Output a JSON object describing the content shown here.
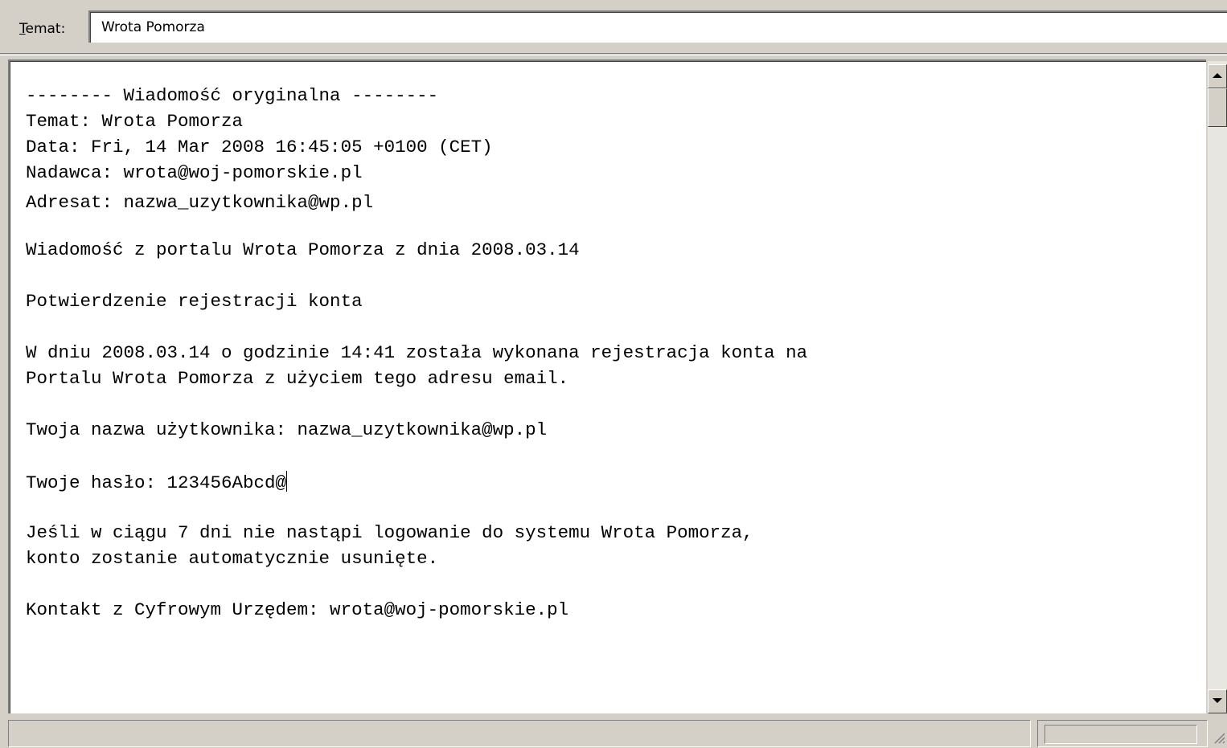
{
  "subject": {
    "label_accel": "T",
    "label_rest": "emat:",
    "value": "Wrota Pomorza"
  },
  "body": {
    "lines": [
      "-------- Wiadomość oryginalna --------",
      "Temat: Wrota Pomorza",
      "Data: Fri, 14 Mar 2008 16:45:05 +0100 (CET)",
      "Nadawca: wrota@woj-pomorskie.pl",
      "Adresat: nazwa_uzytkownika@wp.pl",
      "Wiadomość z portalu Wrota Pomorza z dnia 2008.03.14",
      "Potwierdzenie rejestracji konta",
      "W dniu 2008.03.14 o godzinie 14:41 została wykonana rejestracja konta na",
      "Portalu Wrota Pomorza z użyciem tego adresu email.",
      "Twoja nazwa użytkownika: nazwa_uzytkownika@wp.pl",
      "Twoje hasło: 123456Abcd@",
      "Jeśli w ciągu 7 dni nie nastąpi logowanie do systemu Wrota Pomorza,",
      "konto zostanie automatycznie usunięte.",
      "Kontakt z Cyfrowym Urzędem: wrota@woj-pomorskie.pl"
    ]
  },
  "icons": {
    "scroll_up": "arrow-up-icon",
    "scroll_down": "arrow-down-icon",
    "resize": "resize-grip-icon"
  }
}
